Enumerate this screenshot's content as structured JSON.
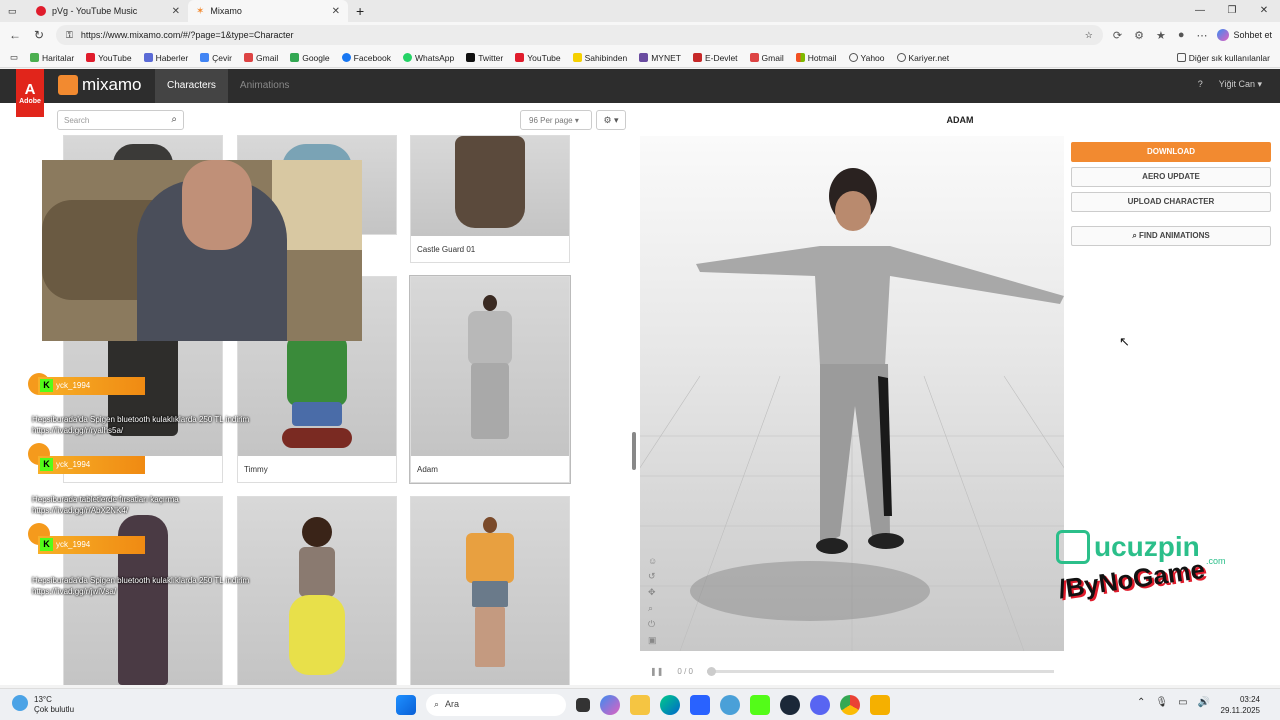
{
  "browser": {
    "tabs": [
      {
        "title": "pVg - YouTube Music",
        "active": false
      },
      {
        "title": "Mixamo",
        "active": true
      }
    ],
    "url": "https://www.mixamo.com/#/?page=1&type=Character",
    "copilot_label": "Sohbet et",
    "bookmarks": [
      "Haritalar",
      "YouTube",
      "Haberler",
      "Çevir",
      "Gmail",
      "Google",
      "Facebook",
      "WhatsApp",
      "Twitter",
      "YouTube",
      "Sahibinden",
      "MYNET",
      "E-Devlet",
      "Gmail",
      "Hotmail",
      "Yahoo",
      "Kariyer.net"
    ],
    "other_bookmarks": "Diğer sık kullanılanlar"
  },
  "mixamo": {
    "adobe_label": "Adobe",
    "logo": "mixamo",
    "nav": [
      {
        "label": "Characters",
        "active": true
      },
      {
        "label": "Animations",
        "active": false
      }
    ],
    "help_icon": "?",
    "user": "Yiğit Can",
    "search_placeholder": "Search",
    "per_page": "96 Per page",
    "cards": [
      {
        "label": "",
        "variant": "dark"
      },
      {
        "label": "",
        "variant": "robot"
      },
      {
        "label": "Castle Guard 01",
        "variant": "guard"
      },
      {
        "label": "",
        "variant": "dark"
      },
      {
        "label": "Timmy",
        "variant": "kid"
      },
      {
        "label": "Adam",
        "variant": "adam"
      },
      {
        "label": "",
        "variant": "alien"
      },
      {
        "label": "",
        "variant": "girl"
      },
      {
        "label": "",
        "variant": "woman"
      }
    ],
    "selected_character": "ADAM",
    "actions": {
      "download": "DOWNLOAD",
      "aero_update": "AERO UPDATE",
      "upload": "UPLOAD CHARACTER",
      "find": "FIND ANIMATIONS"
    },
    "player_time": "0 / 0"
  },
  "overlay": {
    "chat": [
      {
        "user": "yck_1994",
        "message": "Hepsiburada'da Spigen bluetooth kulaklıklarda 250 TL indirim https://livad.gg/r/ryalhs5a/"
      },
      {
        "user": "yck_1994",
        "message": "Hepsiburada tabletlerde fırsatları kaçırma https://livad.gg/r/AbX2NK4/"
      },
      {
        "user": "yck_1994",
        "message": "Hepsiburada'da Spigen bluetooth kulaklıklarda 250 TL indirim https://livad.gg/r/jwlVsa/"
      }
    ],
    "sponsor": "ucuzpin",
    "sponsor_sub": ".com",
    "brand": "/ByNoGame"
  },
  "taskbar": {
    "temperature": "13°C",
    "weather": "Çok bulutlu",
    "search": "Ara",
    "time": "03:24",
    "date": "29.11.2025"
  }
}
